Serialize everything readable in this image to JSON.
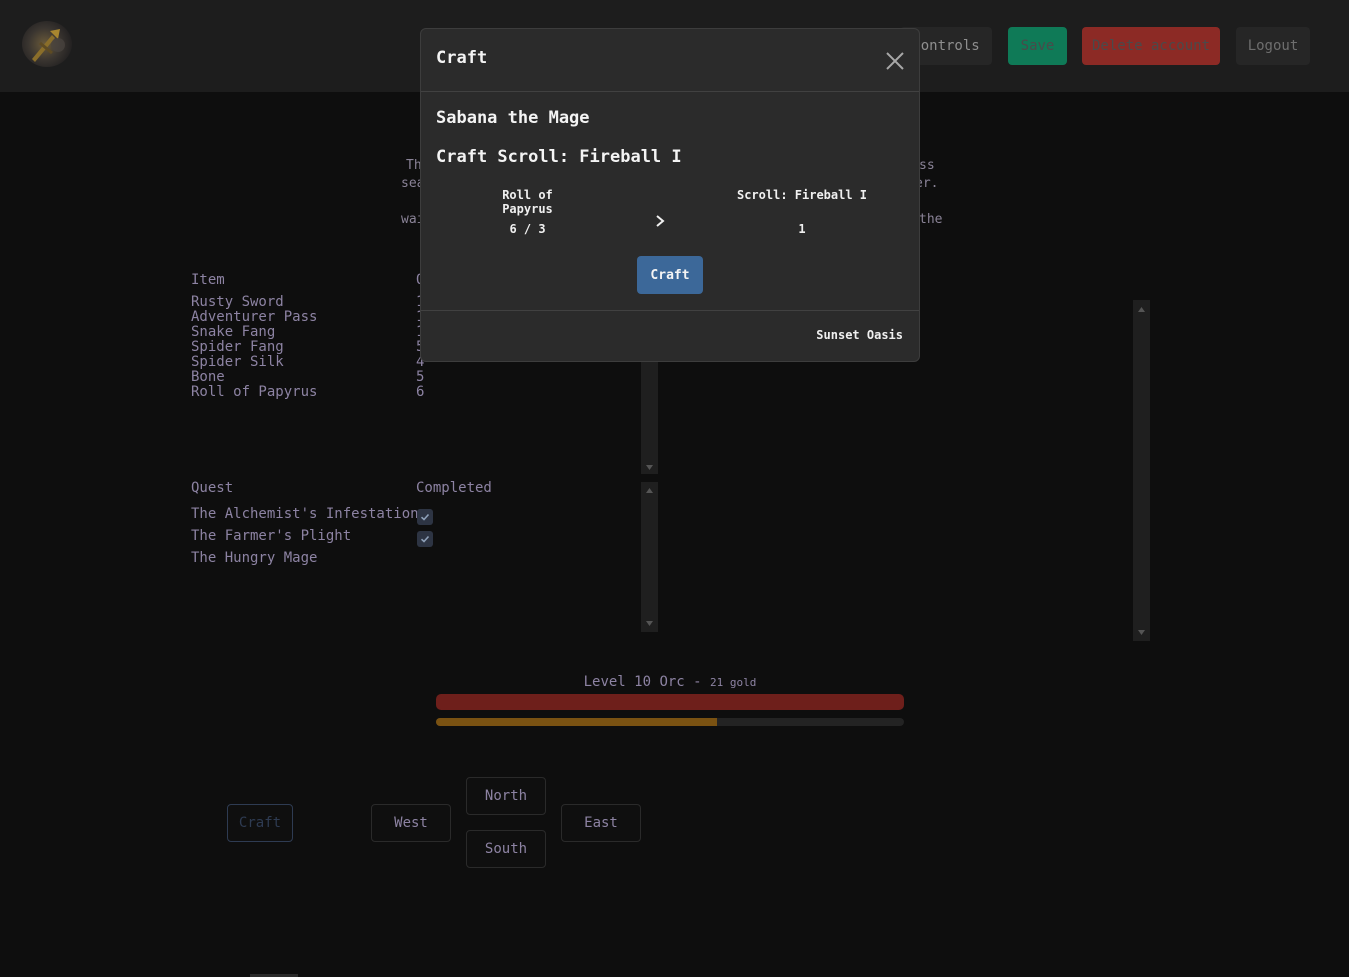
{
  "header": {
    "buttons": {
      "controls": "Controls",
      "save": "Save",
      "delete_account": "Delete account",
      "logout": "Logout"
    },
    "colors": {
      "save": "#0f7a57",
      "delete": "#8c2a25",
      "header_bg": "#1d1d1d"
    }
  },
  "story": {
    "fragments": [
      "Th",
      "sea",
      "wai",
      "ss",
      "er.",
      "the"
    ]
  },
  "inventory": {
    "headers": {
      "item": "Item",
      "qty": "Q"
    },
    "items": [
      {
        "name": "Rusty Sword",
        "qty": "1"
      },
      {
        "name": "Adventurer Pass",
        "qty": "1"
      },
      {
        "name": "Snake Fang",
        "qty": "1"
      },
      {
        "name": "Spider Fang",
        "qty": "5"
      },
      {
        "name": "Spider Silk",
        "qty": "4"
      },
      {
        "name": "Bone",
        "qty": "5"
      },
      {
        "name": "Roll of Papyrus",
        "qty": "6"
      }
    ]
  },
  "quests": {
    "headers": {
      "quest": "Quest",
      "completed": "Completed"
    },
    "rows": [
      {
        "name": "The Alchemist's Infestation",
        "completed": true
      },
      {
        "name": "The Farmer's Plight",
        "completed": true
      },
      {
        "name": "The Hungry Mage",
        "completed": false
      }
    ]
  },
  "status": {
    "level_text": "Level 10 Orc - ",
    "gold_text": "21 gold",
    "hp_fraction": 1.0,
    "xp_fraction": 0.6,
    "colors": {
      "hp": "#6e1f1b",
      "xp": "#7a5212"
    }
  },
  "movement": {
    "craft": "Craft",
    "west": "West",
    "north": "North",
    "south": "South",
    "east": "East"
  },
  "modal": {
    "title": "Craft",
    "npc": "Sabana the Mage",
    "recipe_title": "Craft Scroll: Fireball I",
    "ingredient": {
      "name": "Roll of Papyrus",
      "qty": "6 / 3"
    },
    "output": {
      "name": "Scroll: Fireball I",
      "qty": "1"
    },
    "craft_button": "Craft",
    "location": "Sunset Oasis",
    "colors": {
      "bg": "#2b2b2b",
      "button": "#3c6899"
    }
  }
}
